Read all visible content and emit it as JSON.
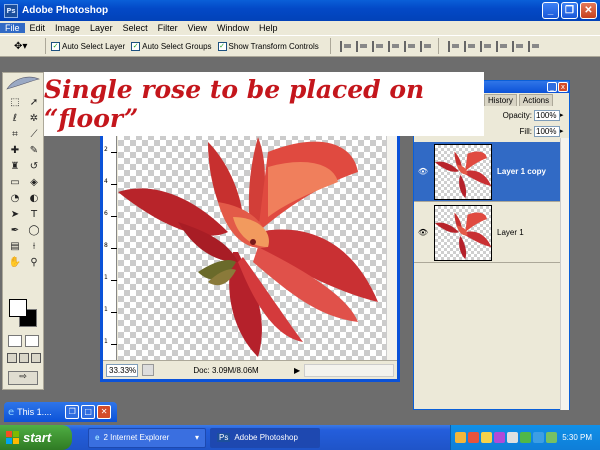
{
  "window": {
    "title": "Adobe Photoshop",
    "icon": "photoshop-icon"
  },
  "menu": [
    "File",
    "Edit",
    "Image",
    "Layer",
    "Select",
    "Filter",
    "View",
    "Window",
    "Help"
  ],
  "options_bar": {
    "auto_select_layer": "Auto Select Layer",
    "auto_select_groups": "Auto Select Groups",
    "show_transform_controls": "Show Transform Controls"
  },
  "caption": "Single rose to be placed on “floor”",
  "document": {
    "zoom": "33.33%",
    "doc_info": "Doc: 3.09M/8.06M",
    "ruler_labels": [
      "2",
      "4",
      "6",
      "8",
      "1",
      "1",
      "1"
    ]
  },
  "layers_panel": {
    "tabs": [
      "History",
      "Actions"
    ],
    "opacity_label": "Opacity:",
    "opacity_value": "100%",
    "fill_label": "Fill:",
    "fill_value": "100%",
    "layers": [
      {
        "name": "Layer 1 copy",
        "selected": true
      },
      {
        "name": "Layer 1",
        "selected": false
      }
    ]
  },
  "minimized_window": {
    "title": "This 1...."
  },
  "taskbar": {
    "start_label": "start",
    "tasks": [
      {
        "label": "2 Internet Explorer"
      },
      {
        "label": "Adobe Photoshop"
      }
    ],
    "clock": "5:30 PM"
  },
  "colors": {
    "xp_blue": "#0b52d8",
    "caption_red": "#c4161c",
    "selection": "#316ac5",
    "rose_red": "#d63a3a"
  }
}
